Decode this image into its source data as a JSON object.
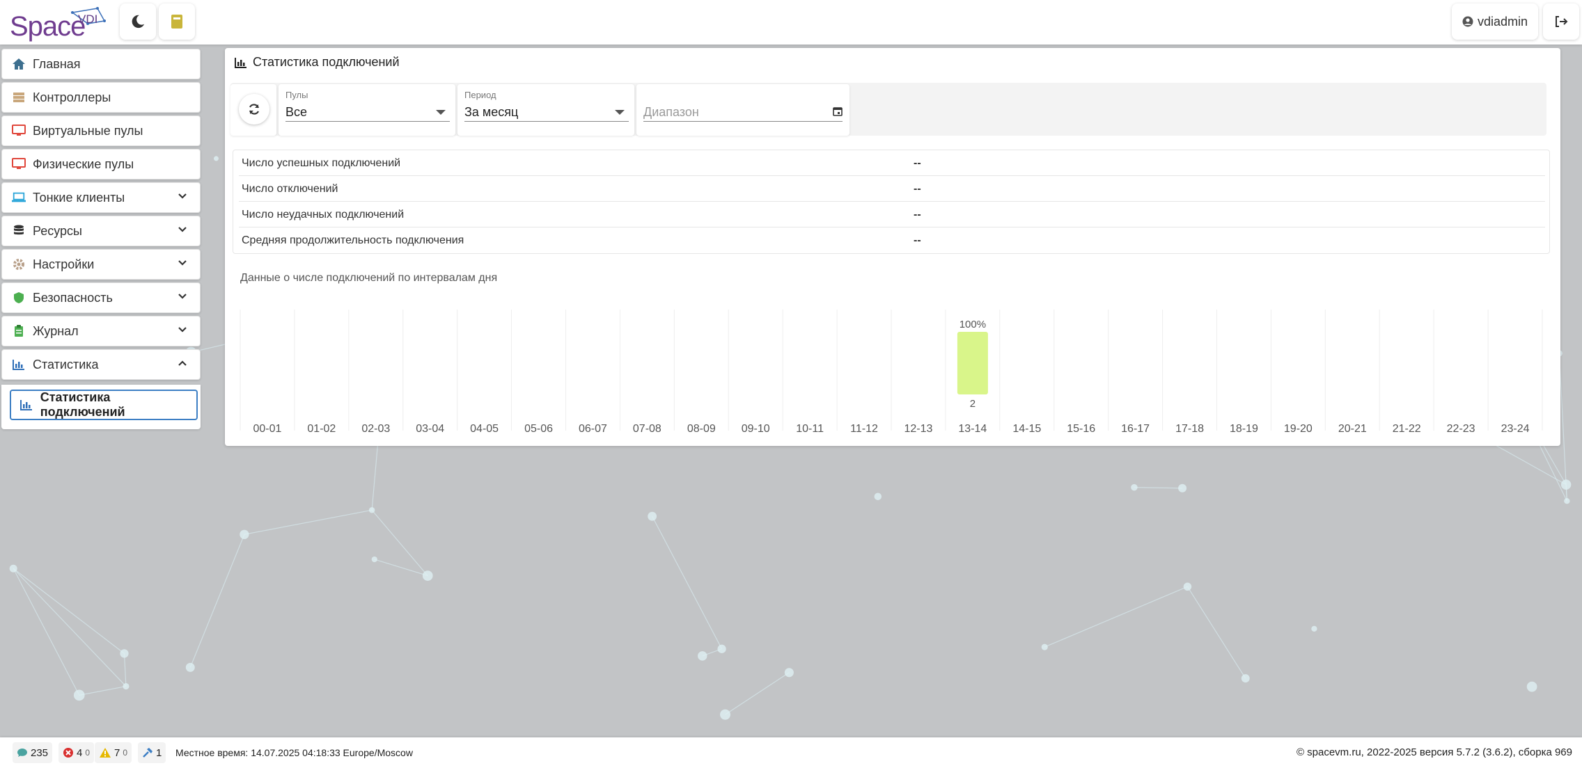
{
  "header": {
    "logo_text": "Space",
    "logo_badge": "VDI",
    "theme_icon": "moon-icon",
    "docs_icon": "book-icon",
    "user_name": "vdiadmin",
    "user_icon": "user-circle-icon",
    "logout_icon": "sign-out-icon"
  },
  "sidebar": {
    "items": [
      {
        "label": "Главная",
        "icon": "home-icon",
        "color": "#3d6f8f"
      },
      {
        "label": "Контроллеры",
        "icon": "server-icon",
        "color": "#c9a77c"
      },
      {
        "label": "Виртуальные пулы",
        "icon": "desktop-icon",
        "color": "#e0473c"
      },
      {
        "label": "Физические пулы",
        "icon": "desktop-icon",
        "color": "#e0473c"
      },
      {
        "label": "Тонкие клиенты",
        "icon": "laptop-icon",
        "color": "#2ba6d9"
      },
      {
        "label": "Ресурсы",
        "icon": "database-icon",
        "color": "#333333"
      },
      {
        "label": "Настройки",
        "icon": "gear-icon",
        "color": "#b8a08a"
      },
      {
        "label": "Безопасность",
        "icon": "shield-icon",
        "color": "#4caf50"
      },
      {
        "label": "Журнал",
        "icon": "clipboard-icon",
        "color": "#4caf50"
      },
      {
        "label": "Статистика",
        "icon": "chart-icon",
        "color": "#2f6fb8"
      }
    ],
    "sub_item": "Статистика подключений"
  },
  "panel": {
    "title": "Статистика подключений",
    "filters": {
      "pools_label": "Пулы",
      "pools_value": "Все",
      "period_label": "Период",
      "period_value": "За месяц",
      "range_placeholder": "Диапазон"
    },
    "stats": [
      {
        "label": "Число успешных подключений",
        "value": "--"
      },
      {
        "label": "Число отключений",
        "value": "--"
      },
      {
        "label": "Число неудачных подключений",
        "value": "--"
      },
      {
        "label": "Средняя продолжительность подключения",
        "value": "--"
      }
    ],
    "chart_title": "Данные о числе подключений по интервалам дня"
  },
  "chart_data": {
    "type": "bar",
    "title": "Данные о числе подключений по интервалам дня",
    "categories": [
      "00-01",
      "01-02",
      "02-03",
      "03-04",
      "04-05",
      "05-06",
      "06-07",
      "07-08",
      "08-09",
      "09-10",
      "10-11",
      "11-12",
      "12-13",
      "13-14",
      "14-15",
      "15-16",
      "16-17",
      "17-18",
      "18-19",
      "19-20",
      "20-21",
      "21-22",
      "22-23",
      "23-24"
    ],
    "values": [
      0,
      0,
      0,
      0,
      0,
      0,
      0,
      0,
      0,
      0,
      0,
      0,
      0,
      2,
      0,
      0,
      0,
      0,
      0,
      0,
      0,
      0,
      0,
      0
    ],
    "percent_labels": {
      "13": "100%"
    },
    "bar_color": "#d9f58a",
    "ylim": [
      0,
      2
    ],
    "grid": true
  },
  "footer": {
    "messages": "235",
    "errors": "4",
    "errors_sub": "0",
    "warnings": "7",
    "warnings_sub": "0",
    "tasks": "1",
    "local_time": "Местное время: 14.07.2025 04:18:33 Europe/Moscow",
    "copyright": "© spacevm.ru, 2022-2025 версия 5.7.2 (3.6.2), сборка 969"
  }
}
